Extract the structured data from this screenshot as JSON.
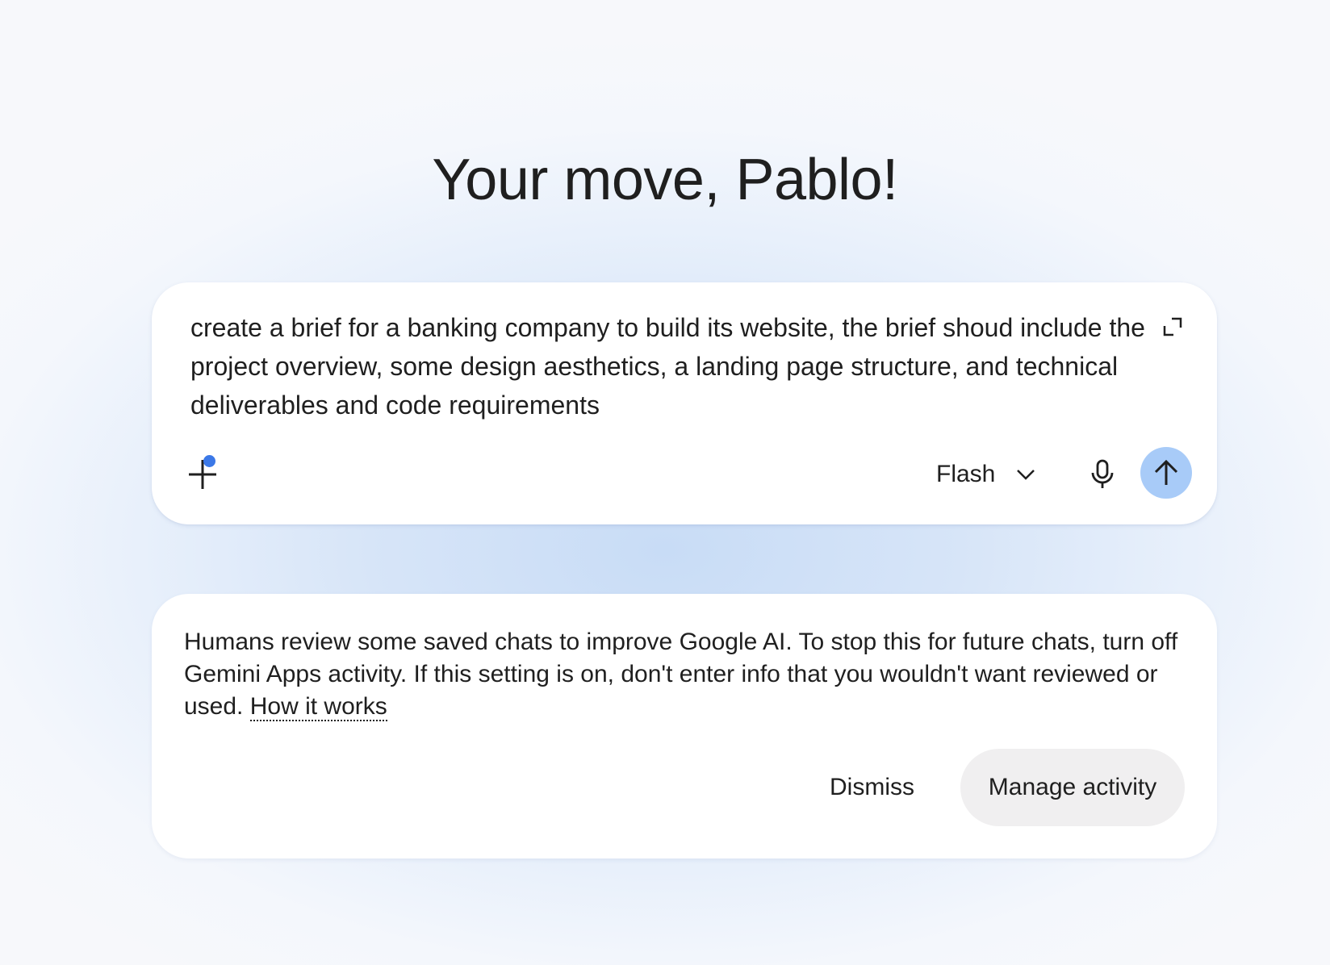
{
  "greeting": "Your move, Pablo!",
  "prompt": {
    "text": "create a brief for a banking company to build its website, the brief shoud include the project overview, some design aesthetics, a landing page structure, and technical deliverables and code requirements",
    "expand_icon": "expand-icon",
    "add_icon": "plus-icon",
    "model": "Flash",
    "model_icon": "chevron-down-icon",
    "mic_icon": "microphone-icon",
    "send_icon": "arrow-up-icon",
    "send_color": "#a8cbf8",
    "notification_color": "#3b78e7"
  },
  "notice": {
    "text": "Humans review some saved chats to improve Google AI. To stop this for future chats, turn off Gemini Apps activity. If this setting is on, don't enter info that you wouldn't want reviewed or used. ",
    "link": "How it works",
    "dismiss_label": "Dismiss",
    "manage_label": "Manage activity"
  }
}
